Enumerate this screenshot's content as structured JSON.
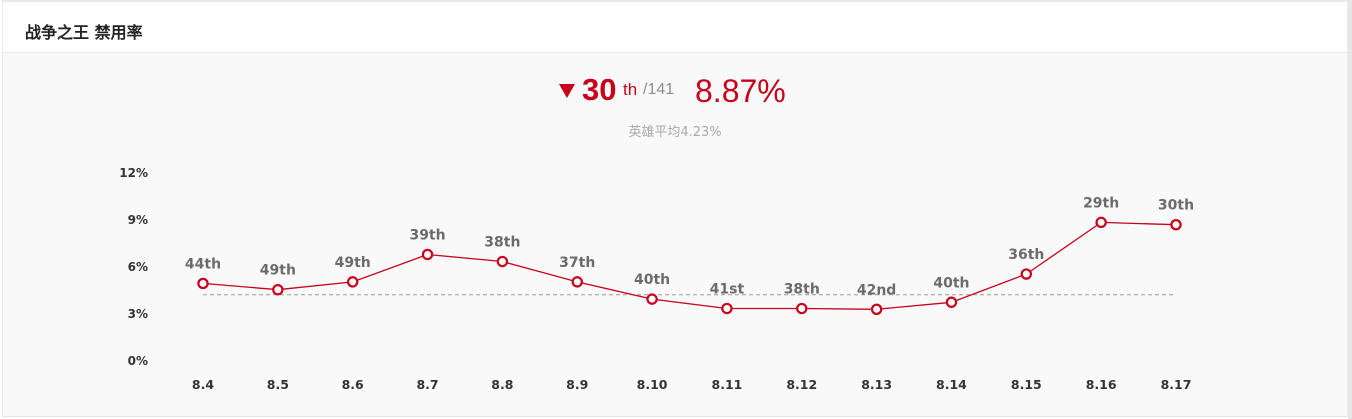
{
  "header": {
    "title": "战争之王 禁用率"
  },
  "summary": {
    "trend": "down",
    "rank": "30",
    "rank_suffix": "th",
    "rank_total": "/141",
    "rate": "8.87%",
    "average_text": "英雄平均4.23%"
  },
  "colors": {
    "accent": "#c9001a",
    "average_line": "#999999",
    "muted_text": "#a9a9a9"
  },
  "chart_data": {
    "type": "line",
    "title": "",
    "xlabel": "",
    "ylabel": "",
    "categories": [
      "8.4",
      "8.5",
      "8.6",
      "8.7",
      "8.8",
      "8.9",
      "8.10",
      "8.11",
      "8.12",
      "8.13",
      "8.14",
      "8.15",
      "8.16",
      "8.17"
    ],
    "series": [
      {
        "values": [
          4.95,
          4.55,
          5.05,
          6.8,
          6.35,
          5.05,
          3.95,
          3.35,
          3.35,
          3.3,
          3.75,
          5.55,
          8.85,
          8.7
        ],
        "point_labels": [
          "44th",
          "49th",
          "49th",
          "39th",
          "38th",
          "37th",
          "40th",
          "41st",
          "38th",
          "42nd",
          "40th",
          "36th",
          "29th",
          "30th"
        ]
      }
    ],
    "reference_line": {
      "value": 4.23,
      "style": "dashed"
    },
    "yticks": [
      "12%",
      "9%",
      "6%",
      "3%",
      "0%"
    ],
    "ytick_values": [
      12,
      9,
      6,
      3,
      0
    ],
    "ylim": [
      0,
      12
    ],
    "grid": false,
    "legend": "none"
  }
}
